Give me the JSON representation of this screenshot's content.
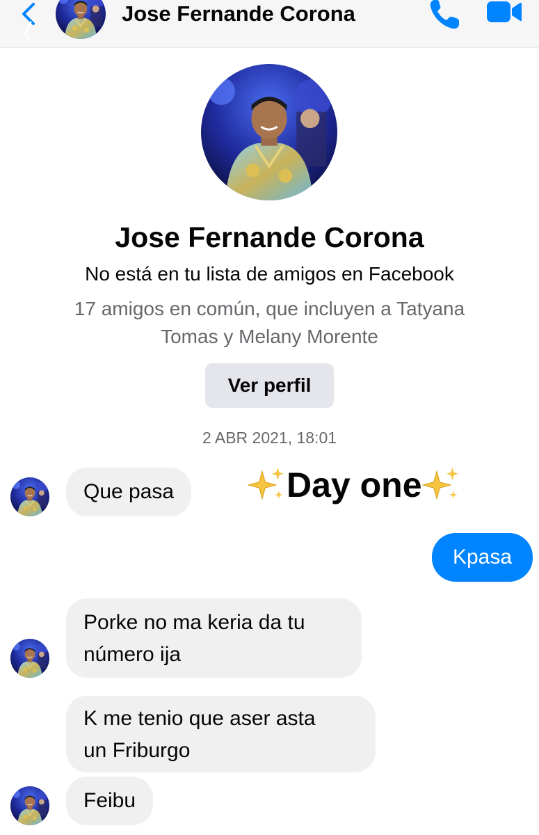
{
  "header": {
    "back_icon": "chevron-left-icon",
    "contact_name": "Jose Fernande Corona",
    "call_icon": "phone-icon",
    "video_icon": "video-camera-icon",
    "accent_color": "#0084ff"
  },
  "profile": {
    "name": "Jose Fernande Corona",
    "status": "No está en tu lista de amigos en Facebook",
    "mutual_friends_line1": "17 amigos en común, que incluyen a Tatyana",
    "mutual_friends_line2": "Tomas y Melany Morente",
    "view_profile_label": "Ver perfil"
  },
  "conversation": {
    "timestamp": "2 ABR 2021, 18:01",
    "overlay_text": "Day one",
    "overlay_icon": "sparkles-icon",
    "messages": [
      {
        "direction": "incoming",
        "lines": [
          "Que pasa"
        ]
      },
      {
        "direction": "outgoing",
        "lines": [
          "Kpasa"
        ]
      },
      {
        "direction": "incoming",
        "lines": [
          "Porke no ma keria da tu",
          "número ija"
        ]
      },
      {
        "direction": "incoming",
        "lines": [
          "K me tenio que aser asta",
          "un Friburgo"
        ]
      },
      {
        "direction": "incoming",
        "lines": [
          "Feibu"
        ]
      }
    ]
  },
  "colors": {
    "incoming_bubble": "#f0f0f0",
    "outgoing_bubble": "#0084ff",
    "secondary_text": "#65676b",
    "button_bg": "#e4e6eb"
  }
}
